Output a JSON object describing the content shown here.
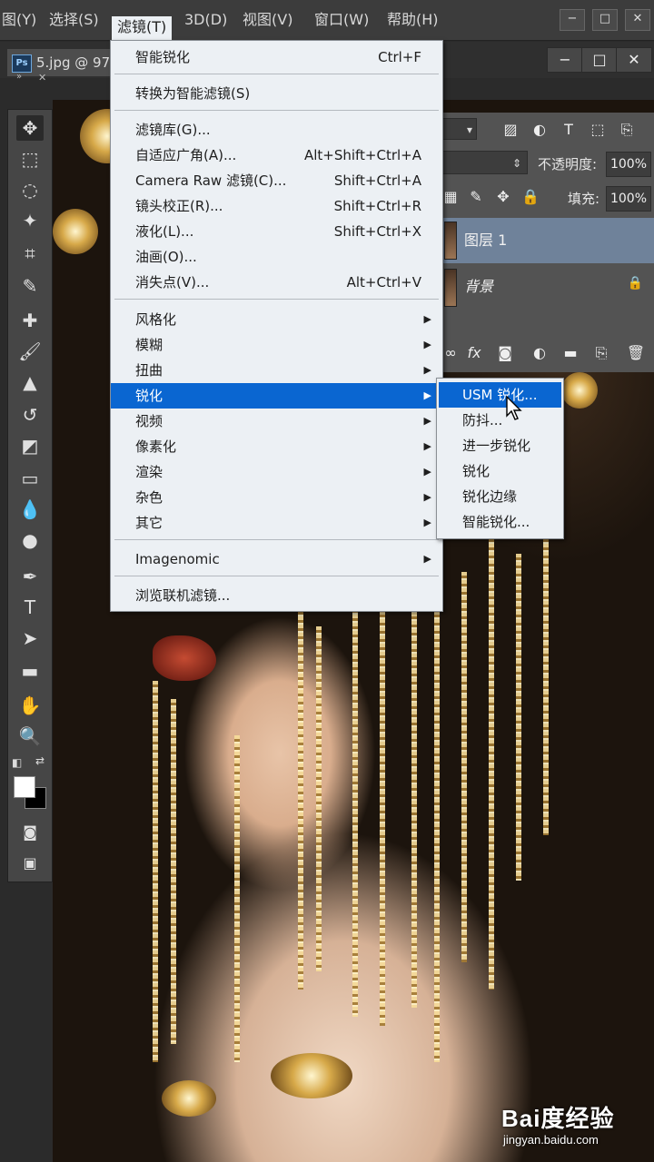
{
  "menubar": {
    "items": [
      "图(Y)",
      "选择(S)",
      "滤镜(T)",
      "3D(D)",
      "视图(V)",
      "窗口(W)",
      "帮助(H)"
    ],
    "active_index": 2
  },
  "window_controls": {
    "minimize": "−",
    "restore": "□",
    "close": "✕"
  },
  "document": {
    "ps_badge": "Ps",
    "tab_label": "5.jpg @ 97"
  },
  "doc_window_controls": {
    "minimize": "−",
    "restore": "□",
    "close": "✕"
  },
  "filter_menu": {
    "items": [
      {
        "label": "智能锐化",
        "shortcut": "Ctrl+F"
      },
      {
        "label": "转换为智能滤镜(S)",
        "shortcut": ""
      },
      {
        "label": "滤镜库(G)...",
        "shortcut": ""
      },
      {
        "label": "自适应广角(A)...",
        "shortcut": "Alt+Shift+Ctrl+A"
      },
      {
        "label": "Camera Raw 滤镜(C)...",
        "shortcut": "Shift+Ctrl+A"
      },
      {
        "label": "镜头校正(R)...",
        "shortcut": "Shift+Ctrl+R"
      },
      {
        "label": "液化(L)...",
        "shortcut": "Shift+Ctrl+X"
      },
      {
        "label": "油画(O)...",
        "shortcut": ""
      },
      {
        "label": "消失点(V)...",
        "shortcut": "Alt+Ctrl+V"
      },
      {
        "label": "风格化",
        "submenu": true
      },
      {
        "label": "模糊",
        "submenu": true
      },
      {
        "label": "扭曲",
        "submenu": true
      },
      {
        "label": "锐化",
        "submenu": true,
        "highlighted": true
      },
      {
        "label": "视频",
        "submenu": true
      },
      {
        "label": "像素化",
        "submenu": true
      },
      {
        "label": "渲染",
        "submenu": true
      },
      {
        "label": "杂色",
        "submenu": true
      },
      {
        "label": "其它",
        "submenu": true
      },
      {
        "label": "Imagenomic",
        "submenu": true
      },
      {
        "label": "浏览联机滤镜...",
        "shortcut": ""
      }
    ]
  },
  "sharpen_submenu": {
    "items": [
      {
        "label": "USM 锐化...",
        "highlighted": true
      },
      {
        "label": "防抖..."
      },
      {
        "label": "进一步锐化"
      },
      {
        "label": "锐化"
      },
      {
        "label": "锐化边缘"
      },
      {
        "label": "智能锐化..."
      }
    ]
  },
  "layers_panel": {
    "opacity_label": "不透明度:",
    "opacity_value": "100%",
    "fill_label": "填充:",
    "fill_value": "100%",
    "layers": [
      {
        "name": "图层 1",
        "selected": true
      },
      {
        "name": "背景",
        "locked": true
      }
    ]
  },
  "toolbar": {
    "tools": [
      "move-tool",
      "marquee-tool",
      "lasso-tool",
      "magic-wand-tool",
      "crop-tool",
      "eyedropper-tool",
      "healing-brush-tool",
      "brush-tool",
      "clone-stamp-tool",
      "history-brush-tool",
      "eraser-tool",
      "gradient-tool",
      "blur-tool",
      "dodge-tool",
      "pen-tool",
      "type-tool",
      "path-selection-tool",
      "rectangle-tool",
      "hand-tool",
      "zoom-tool"
    ],
    "foreground_color": "#ffffff",
    "background_color": "#000000"
  },
  "watermark": {
    "brand": "Bai度经验",
    "url": "jingyan.baidu.com"
  }
}
